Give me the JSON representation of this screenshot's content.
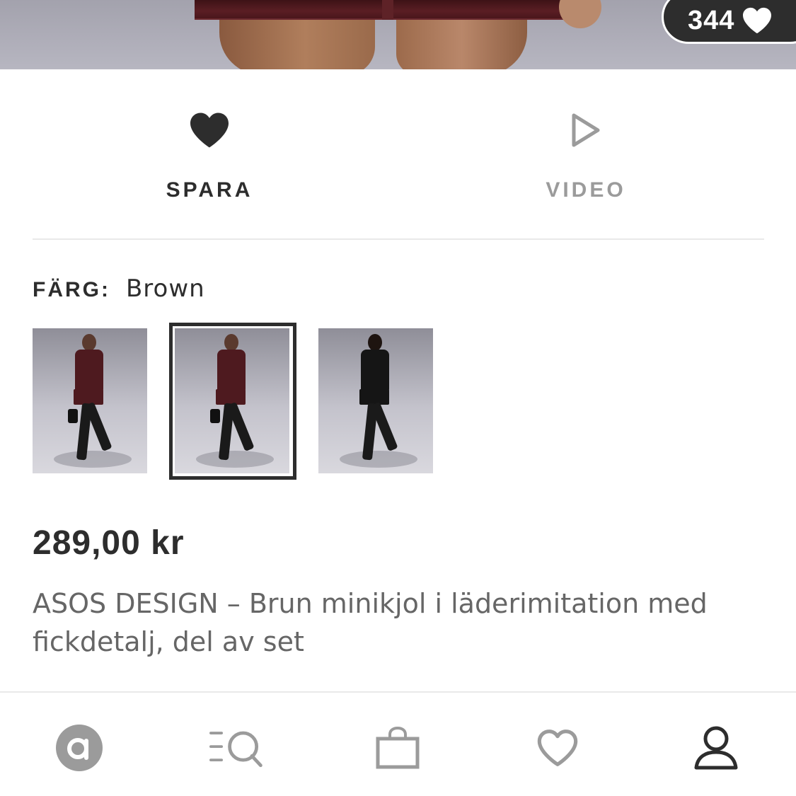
{
  "hero": {
    "likes_count": "344"
  },
  "actions": {
    "save_label": "SPARA",
    "video_label": "VIDEO"
  },
  "color": {
    "label": "FÄRG:",
    "value": "Brown",
    "options": [
      {
        "name": "Brown",
        "selected": false
      },
      {
        "name": "Brown",
        "selected": true
      },
      {
        "name": "Black",
        "selected": false
      }
    ]
  },
  "product": {
    "price": "289,00 kr",
    "title": "ASOS DESIGN – Brun minikjol i läderimitation med fickdetalj, del av set"
  },
  "nav": {
    "items": [
      {
        "icon": "asos-home-icon",
        "active": false
      },
      {
        "icon": "search-categories-icon",
        "active": false
      },
      {
        "icon": "bag-icon",
        "active": false
      },
      {
        "icon": "saved-heart-icon",
        "active": false
      },
      {
        "icon": "account-icon",
        "active": true
      }
    ]
  },
  "colors": {
    "text_primary": "#2d2d2d",
    "text_secondary": "#666666",
    "inactive_gray": "#9b9b9b",
    "divider": "#e9e9e9"
  }
}
